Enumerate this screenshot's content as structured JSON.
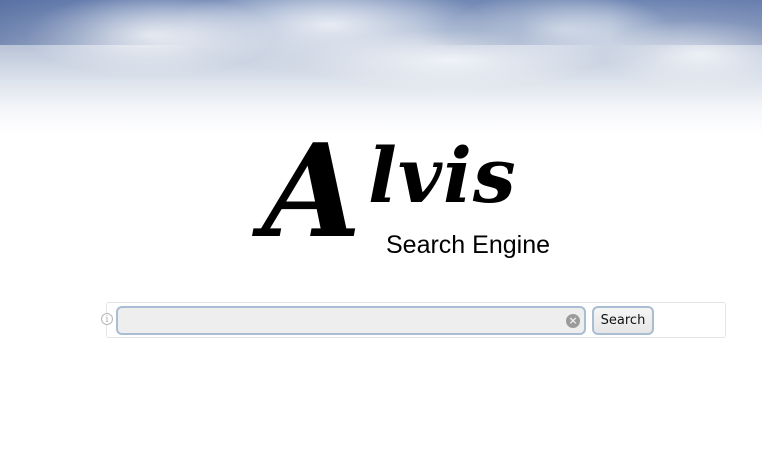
{
  "logo": {
    "big_letter": "A",
    "rest": "lvis",
    "subtitle": "Search Engine"
  },
  "search": {
    "value": "",
    "placeholder": "",
    "button_label": "Search",
    "info_icon": "info-icon",
    "clear_icon": "clear-icon"
  },
  "colors": {
    "input_border": "#a9bdd3",
    "input_bg": "#eeeeee",
    "sky_top": "#6f86b4"
  }
}
